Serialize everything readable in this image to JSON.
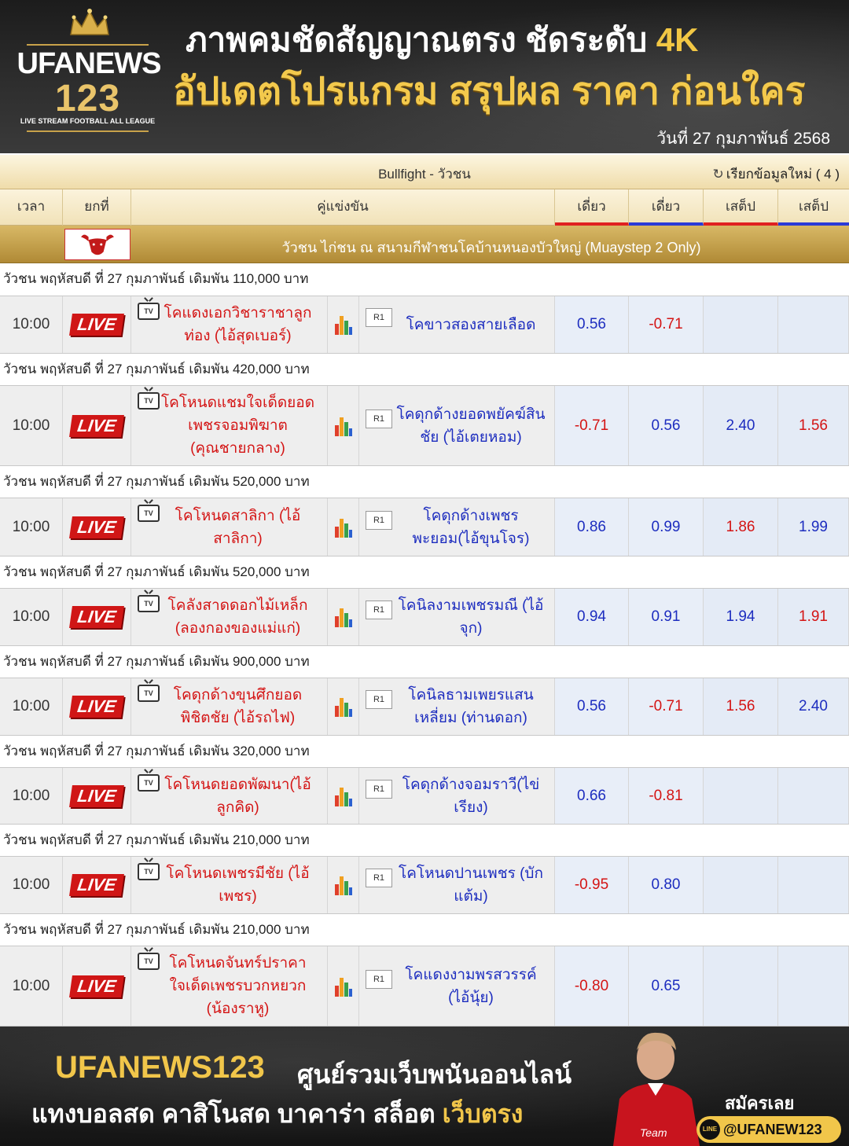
{
  "banner_top": {
    "logo_word": "UFANEWS",
    "logo_number": "123",
    "logo_subtitle": "LIVE STREAM FOOTBALL ALL LEAGUE",
    "headline_main": "ภาพคมชัดสัญญาณตรง ชัดระดับ ",
    "headline_accent": "4K",
    "headline_sub": "อัปเดตโปรแกรม สรุปผล ราคา ก่อนใคร",
    "date": "วันที่ 27 กุมภาพันธ์ 2568",
    "colors": {
      "gold": "#f3c94c",
      "background": "#2e2e2e"
    }
  },
  "table": {
    "title": "Bullfight - วัวชน",
    "refresh_label": "เรียกข้อมูลใหม่ ( 4 )",
    "refresh_icon": "refresh-icon",
    "columns": {
      "time": "เวลา",
      "round": "ยกที่",
      "match": "คู่แข่งขัน",
      "odd1": "เดี่ยว",
      "odd2": "เดี่ยว",
      "odd3": "เสต็ป",
      "odd4": "เสต็ป"
    },
    "league": {
      "name": "วัวชน ไก่ชน ณ สนามกีฬาชนโคบ้านหนองบัวใหญ่ (Muaystep 2 Only)",
      "icon": "bull-icon"
    },
    "live_label": "LIVE",
    "round_badge": "R1",
    "tv_label": "TV",
    "matches": [
      {
        "group": "วัวชน พฤหัสบดี ที่ 27 กุมภาพันธ์ เดิมพัน 110,000 บาท",
        "time": "10:00",
        "home": "โคแดงเอกวิชาราชาลูกท่อง (ไอ้สุดเบอร์)",
        "away": "โคขาวสองสายเลือด",
        "odds": [
          "0.56",
          "-0.71",
          "",
          ""
        ]
      },
      {
        "group": "วัวชน พฤหัสบดี ที่ 27 กุมภาพันธ์ เดิมพัน 420,000 บาท",
        "time": "10:00",
        "home": "โคโหนดแชมใจเด็ดยอดเพชรจอมพิฆาต (คุณชายกลาง)",
        "away": "โคดุกด้างยอดพยัคฆ์สินชัย (ไอ้เตยหอม)",
        "odds": [
          "-0.71",
          "0.56",
          "2.40",
          "1.56"
        ]
      },
      {
        "group": "วัวชน พฤหัสบดี ที่ 27 กุมภาพันธ์ เดิมพัน 520,000 บาท",
        "time": "10:00",
        "home": "โคโหนดสาลิกา (ไอ้สาลิกา)",
        "away": "โคดุกด้างเพชรพะยอม(ไอ้ขุนโจร)",
        "odds": [
          "0.86",
          "0.99",
          "1.86",
          "1.99"
        ]
      },
      {
        "group": "วัวชน พฤหัสบดี ที่ 27 กุมภาพันธ์ เดิมพัน 520,000 บาท",
        "time": "10:00",
        "home": "โคลังสาดดอกไม้เหล็ก (ลองกองของแม่แก่)",
        "away": "โคนิลงามเพชรมณี (ไอ้จุก)",
        "odds": [
          "0.94",
          "0.91",
          "1.94",
          "1.91"
        ]
      },
      {
        "group": "วัวชน พฤหัสบดี ที่ 27 กุมภาพันธ์ เดิมพัน 900,000 บาท",
        "time": "10:00",
        "home": "โคดุกด้างขุนศึกยอดพิชิตชัย (ไอ้รถไฟ)",
        "away": "โคนิลธามเพยรแสนเหลี่ยม (ท่านดอก)",
        "odds": [
          "0.56",
          "-0.71",
          "1.56",
          "2.40"
        ]
      },
      {
        "group": "วัวชน พฤหัสบดี ที่ 27 กุมภาพันธ์ เดิมพัน 320,000 บาท",
        "time": "10:00",
        "home": "โคโหนดยอดพัฒนา(ไอ้ลูกคิด)",
        "away": "โคดุกด้างจอมราวี(ไข่เรียง)",
        "odds": [
          "0.66",
          "-0.81",
          "",
          ""
        ]
      },
      {
        "group": "วัวชน พฤหัสบดี ที่ 27 กุมภาพันธ์ เดิมพัน 210,000 บาท",
        "time": "10:00",
        "home": "โคโหนดเพชรมีชัย (ไอ้เพชร)",
        "away": "โคโหนดปานเพชร (บักแต้ม)",
        "odds": [
          "-0.95",
          "0.80",
          "",
          ""
        ]
      },
      {
        "group": "วัวชน พฤหัสบดี ที่ 27 กุมภาพันธ์ เดิมพัน 210,000 บาท",
        "time": "10:00",
        "home": "โคโหนดจันทร์ปราคาใจเด็ดเพชรบวกหยวก (น้องราหู)",
        "away": "โคแดงงามพรสวรรค์ (ไอ้นุ้ย)",
        "odds": [
          "-0.80",
          "0.65",
          "",
          ""
        ]
      }
    ],
    "colors": {
      "home_team": "#d41414",
      "away_team": "#1d2dbf",
      "live": "#d01616",
      "league_bar": "#c9a24a"
    }
  },
  "banner_bottom": {
    "brand": "UFANEWS123",
    "tagline": "ศูนย์รวมเว็บพนันออนไลน์",
    "line2_white": "แทงบอลสด คาสิโนสด บาคาร่า สล็อต ",
    "line2_gold": "เว็บตรง",
    "signup": "สมัครเลย",
    "line_id": "@UFANEW123",
    "line_icon_text": "LINE",
    "player_shirt_text": "Team"
  }
}
